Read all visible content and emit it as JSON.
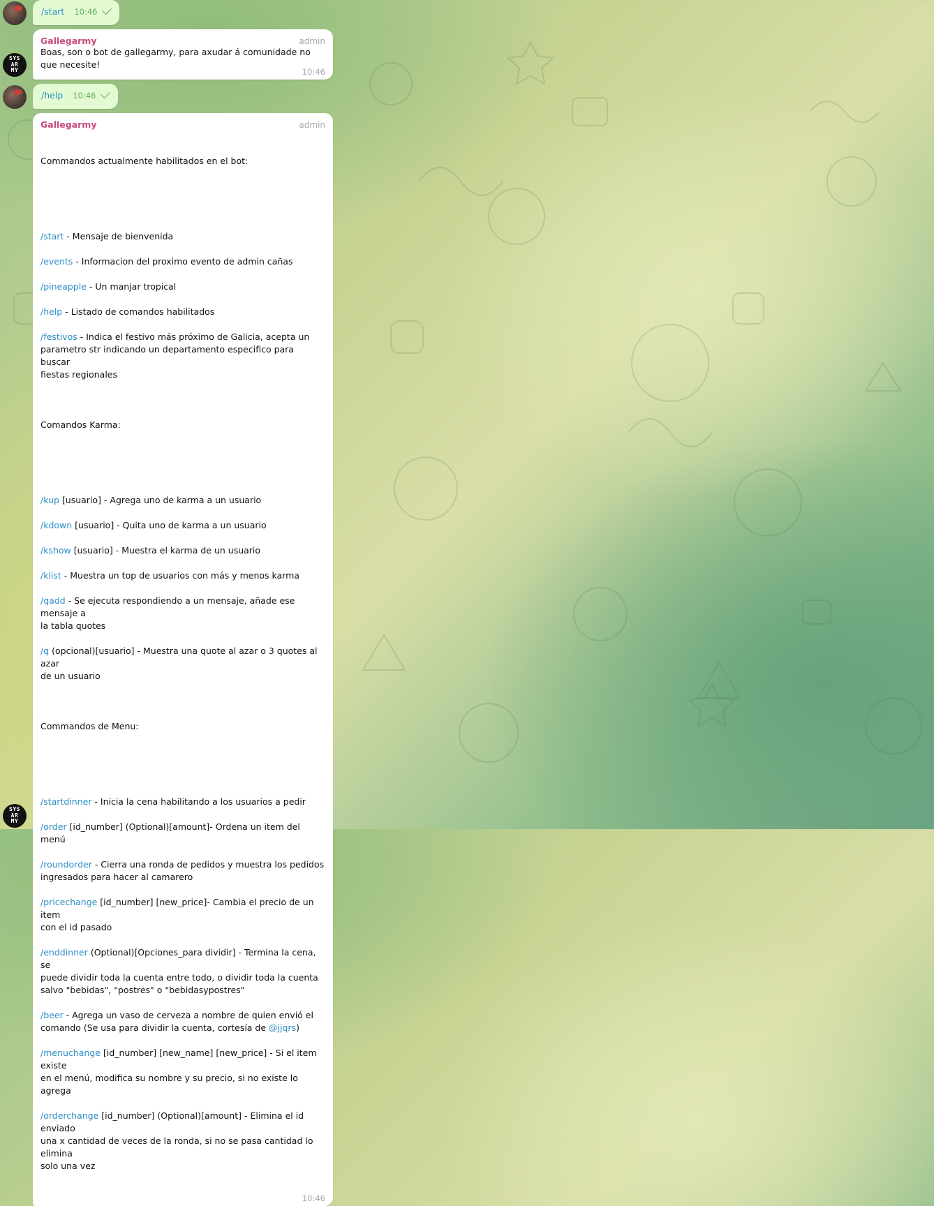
{
  "messages": {
    "start": {
      "text": "/start",
      "time": "10:46"
    },
    "welcome": {
      "sender": "Gallegarmy",
      "role": "admin",
      "text": "Boas, son o bot de gallegarmy, para axudar á comunidade no que necesite!",
      "time": "10:46"
    },
    "help": {
      "text": "/help",
      "time": "10:46"
    },
    "help_reply": {
      "sender": "Gallegarmy",
      "role": "admin",
      "time": "10:46",
      "intro": "Commandos actualmente habilitados en el bot:",
      "basic": [
        {
          "cmd": "/start",
          "desc": " - Mensaje de bienvenida"
        },
        {
          "cmd": "/events",
          "desc": " - Informacion del proximo evento de admin cañas"
        },
        {
          "cmd": "/pineapple",
          "desc": " - Un manjar tropical"
        },
        {
          "cmd": "/help",
          "desc": " - Listado de comandos habilitados"
        },
        {
          "cmd": "/festivos",
          "desc": " - Indica el festivo más próximo de Galicia, acepta un\nparametro str indicando un departamento especifico para buscar\nfiestas regionales"
        }
      ],
      "karma_header": "Comandos Karma:",
      "karma": [
        {
          "cmd": "/kup",
          "desc": " [usuario] - Agrega uno de karma a un usuario"
        },
        {
          "cmd": "/kdown",
          "desc": " [usuario] - Quita uno de karma a un usuario"
        },
        {
          "cmd": "/kshow",
          "desc": " [usuario] - Muestra el karma de un usuario"
        },
        {
          "cmd": "/klist",
          "desc": " - Muestra un top de usuarios con más y menos karma"
        },
        {
          "cmd": "/qadd",
          "desc": " - Se ejecuta respondiendo a un mensaje, añade ese mensaje a\nla tabla quotes"
        },
        {
          "cmd": "/q",
          "desc": " (opcional)[usuario] - Muestra una quote al azar o 3 quotes al azar\nde un usuario"
        }
      ],
      "menu_header": "Commandos de Menu:",
      "menu": [
        {
          "cmd": "/startdinner",
          "desc": " - Inicia la cena habilitando a los usuarios a pedir"
        },
        {
          "cmd": "/order",
          "desc": " [id_number] (Optional)[amount]- Ordena un item del menú"
        },
        {
          "cmd": "/roundorder",
          "desc": " - Cierra una ronda de pedidos y muestra los pedidos\ningresados para hacer al camarero"
        },
        {
          "cmd": "/pricechange",
          "desc": " [id_number] [new_price]- Cambia el precio de un item\ncon el id pasado"
        },
        {
          "cmd": "/enddinner",
          "desc": " (Optional)[Opciones_para dividir] - Termina la cena, se\npuede dividir toda la cuenta entre todo, o dividir toda la cuenta\nsalvo \"bebidas\", \"postres\" o \"bebidasypostres\""
        },
        {
          "cmd": "/beer",
          "desc": " - Agrega un vaso de cerveza a nombre de quien envió el\ncomando (Se usa para dividir la cuenta, cortesía de ",
          "mention": "@jjqrs",
          "tail": ")"
        },
        {
          "cmd": "/menuchange",
          "desc": " [id_number] [new_name] [new_price] - Si el item existe\nen el menú, modifica su nombre y su precio, si no existe lo agrega"
        },
        {
          "cmd": "/orderchange",
          "desc": " [id_number] (Optional)[amount] - Elimina el id enviado\nuna x cantidad de veces de la ronda, si no se pasa cantidad lo elimina\nsolo una vez"
        }
      ]
    }
  },
  "avatars": {
    "bot_text": [
      "SYS",
      "AR",
      "MY"
    ]
  },
  "colors": {
    "sender": "#c54b7c",
    "command": "#2a8fc9",
    "outgoing_bubble": "#e4fad2"
  }
}
